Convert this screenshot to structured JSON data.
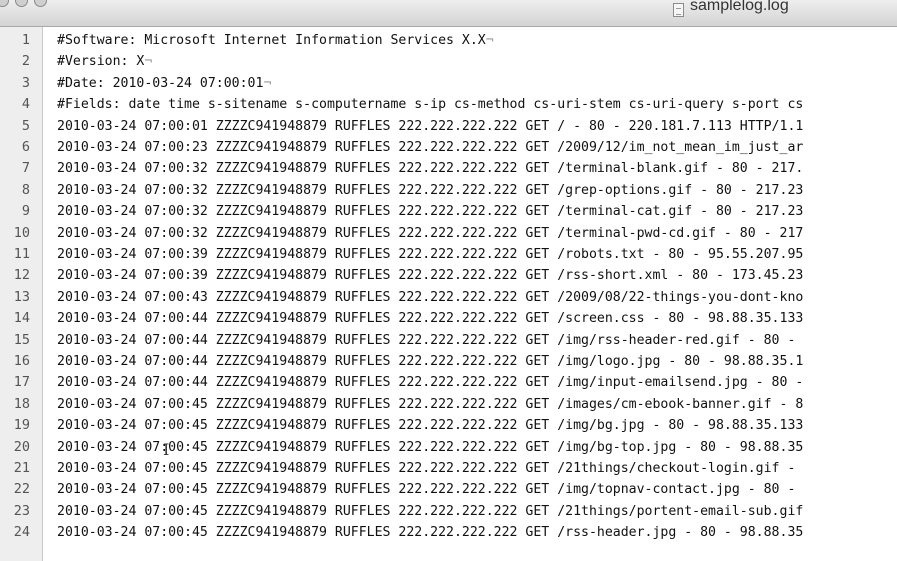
{
  "window": {
    "title": "samplelog.log",
    "file_icon": "document-icon",
    "traffic_light_icons": [
      "close-button-icon",
      "minimize-button-icon",
      "zoom-button-icon"
    ]
  },
  "editor": {
    "eol_marker": "¬",
    "lines": [
      {
        "num": "1",
        "text": "#Software: Microsoft Internet Information Services X.X",
        "eol": true
      },
      {
        "num": "2",
        "text": "#Version: X",
        "eol": true
      },
      {
        "num": "3",
        "text": "#Date: 2010-03-24 07:00:01",
        "eol": true
      },
      {
        "num": "4",
        "text": "#Fields: date time s-sitename s-computername s-ip cs-method cs-uri-stem cs-uri-query s-port cs",
        "eol": false
      },
      {
        "num": "5",
        "text": "2010-03-24 07:00:01 ZZZZC941948879 RUFFLES 222.222.222.222 GET / - 80 - 220.181.7.113 HTTP/1.1",
        "eol": false
      },
      {
        "num": "6",
        "text": "2010-03-24 07:00:23 ZZZZC941948879 RUFFLES 222.222.222.222 GET /2009/12/im_not_mean_im_just_ar",
        "eol": false
      },
      {
        "num": "7",
        "text": "2010-03-24 07:00:32 ZZZZC941948879 RUFFLES 222.222.222.222 GET /terminal-blank.gif - 80 - 217.",
        "eol": false
      },
      {
        "num": "8",
        "text": "2010-03-24 07:00:32 ZZZZC941948879 RUFFLES 222.222.222.222 GET /grep-options.gif - 80 - 217.23",
        "eol": false
      },
      {
        "num": "9",
        "text": "2010-03-24 07:00:32 ZZZZC941948879 RUFFLES 222.222.222.222 GET /terminal-cat.gif - 80 - 217.23",
        "eol": false
      },
      {
        "num": "10",
        "text": "2010-03-24 07:00:32 ZZZZC941948879 RUFFLES 222.222.222.222 GET /terminal-pwd-cd.gif - 80 - 217",
        "eol": false
      },
      {
        "num": "11",
        "text": "2010-03-24 07:00:39 ZZZZC941948879 RUFFLES 222.222.222.222 GET /robots.txt - 80 - 95.55.207.95",
        "eol": false
      },
      {
        "num": "12",
        "text": "2010-03-24 07:00:39 ZZZZC941948879 RUFFLES 222.222.222.222 GET /rss-short.xml - 80 - 173.45.23",
        "eol": false
      },
      {
        "num": "13",
        "text": "2010-03-24 07:00:43 ZZZZC941948879 RUFFLES 222.222.222.222 GET /2009/08/22-things-you-dont-kno",
        "eol": false
      },
      {
        "num": "14",
        "text": "2010-03-24 07:00:44 ZZZZC941948879 RUFFLES 222.222.222.222 GET /screen.css - 80 - 98.88.35.133",
        "eol": false
      },
      {
        "num": "15",
        "text": "2010-03-24 07:00:44 ZZZZC941948879 RUFFLES 222.222.222.222 GET /img/rss-header-red.gif - 80 -",
        "eol": false
      },
      {
        "num": "16",
        "text": "2010-03-24 07:00:44 ZZZZC941948879 RUFFLES 222.222.222.222 GET /img/logo.jpg - 80 - 98.88.35.1",
        "eol": false
      },
      {
        "num": "17",
        "text": "2010-03-24 07:00:44 ZZZZC941948879 RUFFLES 222.222.222.222 GET /img/input-emailsend.jpg - 80 -",
        "eol": false
      },
      {
        "num": "18",
        "text": "2010-03-24 07:00:45 ZZZZC941948879 RUFFLES 222.222.222.222 GET /images/cm-ebook-banner.gif - 8",
        "eol": false
      },
      {
        "num": "19",
        "text": "2010-03-24 07:00:45 ZZZZC941948879 RUFFLES 222.222.222.222 GET /img/bg.jpg - 80 - 98.88.35.133",
        "eol": false
      },
      {
        "num": "20",
        "text": "2010-03-24 07:00:45 ZZZZC941948879 RUFFLES 222.222.222.222 GET /img/bg-top.jpg - 80 - 98.88.35",
        "eol": false
      },
      {
        "num": "21",
        "text": "2010-03-24 07:00:45 ZZZZC941948879 RUFFLES 222.222.222.222 GET /21things/checkout-login.gif -",
        "eol": false
      },
      {
        "num": "22",
        "text": "2010-03-24 07:00:45 ZZZZC941948879 RUFFLES 222.222.222.222 GET /img/topnav-contact.jpg - 80 -",
        "eol": false
      },
      {
        "num": "23",
        "text": "2010-03-24 07:00:45 ZZZZC941948879 RUFFLES 222.222.222.222 GET /21things/portent-email-sub.gif",
        "eol": false
      },
      {
        "num": "24",
        "text": "2010-03-24 07:00:45 ZZZZC941948879 RUFFLES 222.222.222.222 GET /rss-header.jpg - 80 - 98.88.35",
        "eol": false
      }
    ]
  },
  "text_cursor": "I"
}
